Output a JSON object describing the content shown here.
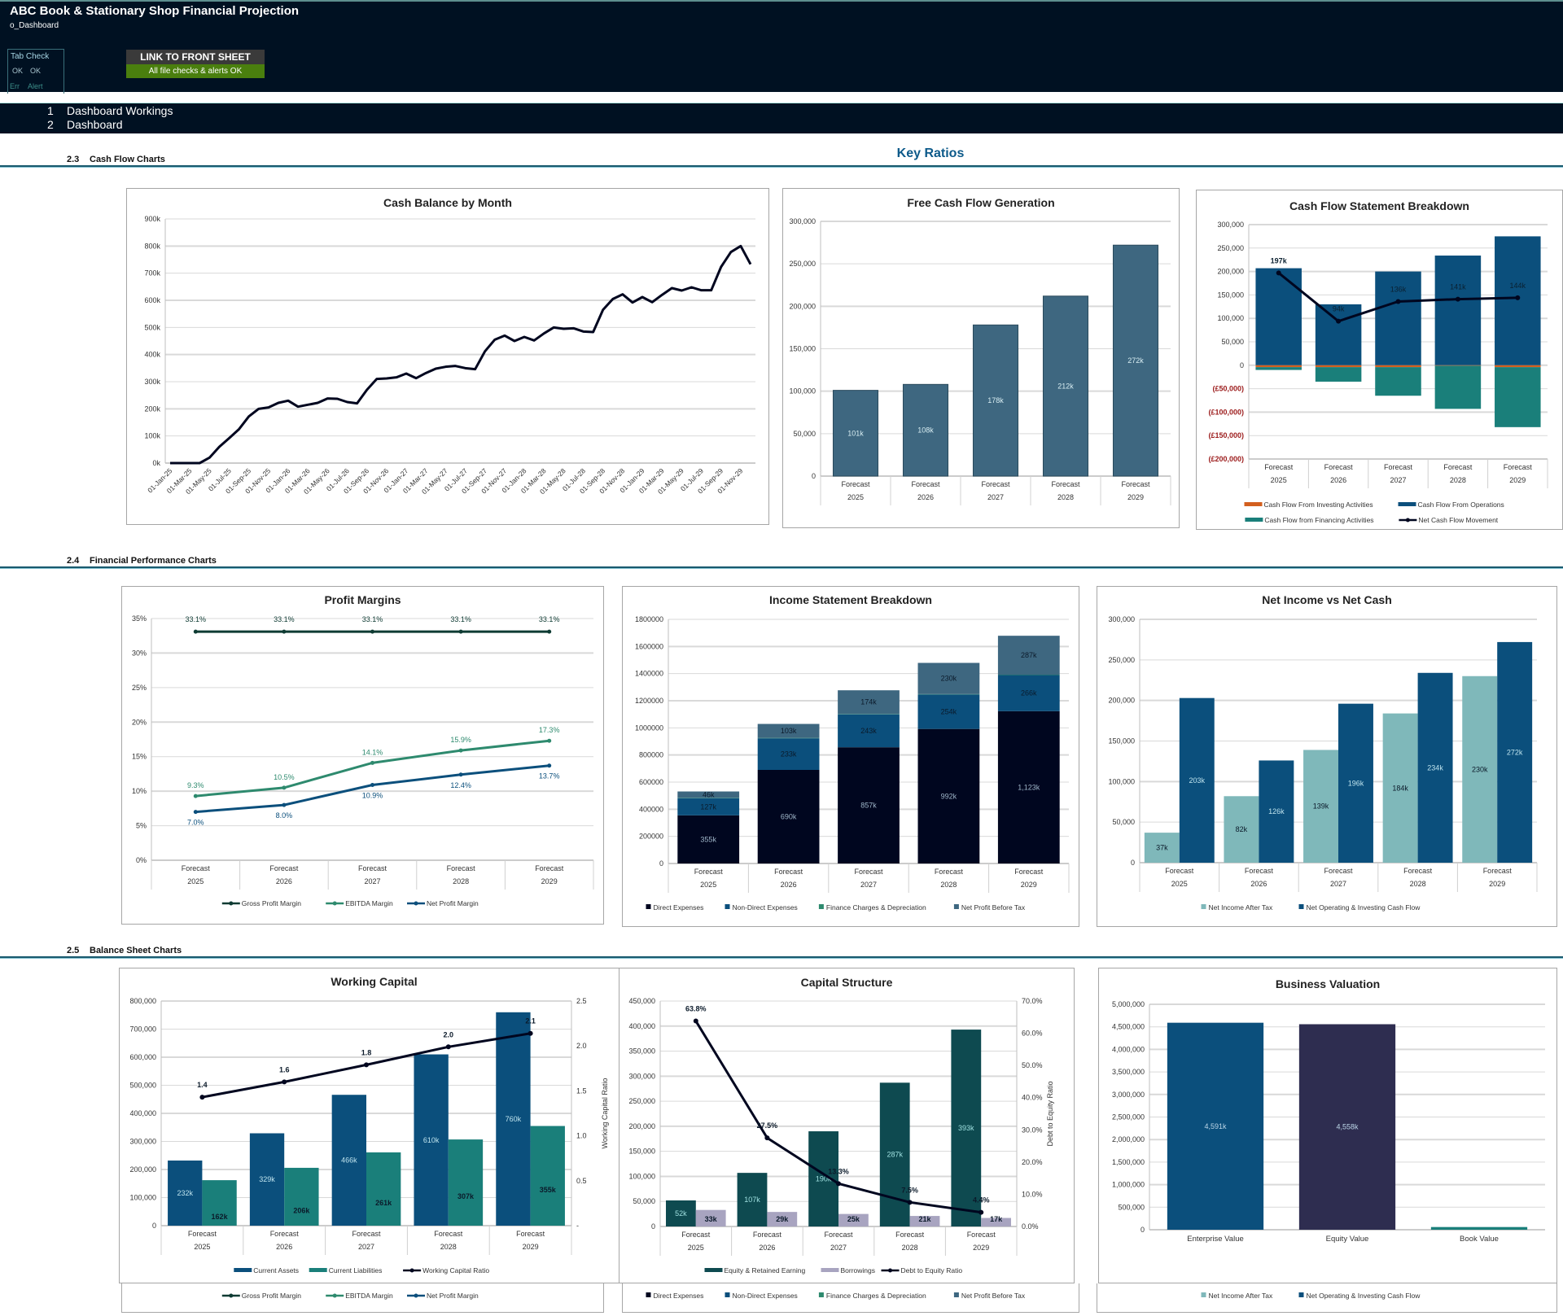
{
  "header": {
    "title": "ABC Book & Stationary Shop Financial Projection",
    "sheet_name": "o_Dashboard",
    "tab_check": {
      "label": "Tab Check",
      "status1": "OK",
      "status2": "OK",
      "err_label": "Err",
      "alert_label": "Alert"
    },
    "link_button": "LINK TO FRONT SHEET",
    "checks_status": "All file checks & alerts OK"
  },
  "nav": [
    {
      "num": "1",
      "label": "Dashboard Workings"
    },
    {
      "num": "2",
      "label": "Dashboard"
    }
  ],
  "key_ratios_title": "Key Ratios",
  "sections": [
    {
      "num": "2.3",
      "label": "Cash Flow Charts"
    },
    {
      "num": "2.4",
      "label": "Financial Performance Charts"
    },
    {
      "num": "2.5",
      "label": "Balance Sheet Charts"
    }
  ],
  "colors": {
    "header_bg": "#001122",
    "ok_green": "#4a7f0e",
    "accent_blue": "#0d5a8a",
    "navy": "#0b4f7c",
    "slate": "#3e6780",
    "teal": "#1a7f7a",
    "light_teal": "#7fb8ba",
    "dark_teal": "#0e4a50",
    "lavender": "#a8a4c0",
    "indigo": "#2e2d50",
    "near_black": "#00061f",
    "orange": "#d35f1e",
    "negative_red": "#9c1c1c"
  },
  "legend_strips": [
    [
      "Gross Profit Margin",
      "EBITDA Margin",
      "Net Profit Margin"
    ],
    [
      "Direct Expenses",
      "Non-Direct Expenses",
      "Finance Charges & Depreciation",
      "Net Profit Before Tax"
    ],
    [
      "Net Income After Tax",
      "Net Operating & Investing Cash Flow"
    ]
  ],
  "chart_data": [
    {
      "id": "cash-balance",
      "type": "line",
      "title": "Cash Balance by Month",
      "xlabel": "",
      "ylabel": "",
      "ylim": [
        0,
        900000
      ],
      "yticks": [
        "0k",
        "100k",
        "200k",
        "300k",
        "400k",
        "500k",
        "600k",
        "700k",
        "800k",
        "900k"
      ],
      "x_tick_labels": [
        "01-Jan-25",
        "01-Mar-25",
        "01-May-25",
        "01-Jul-25",
        "01-Sep-25",
        "01-Nov-25",
        "01-Jan-26",
        "01-Mar-26",
        "01-May-26",
        "01-Jul-26",
        "01-Sep-26",
        "01-Nov-26",
        "01-Jan-27",
        "01-Mar-27",
        "01-May-27",
        "01-Jul-27",
        "01-Sep-27",
        "01-Nov-27",
        "01-Jan-28",
        "01-Mar-28",
        "01-May-28",
        "01-Jul-28",
        "01-Sep-28",
        "01-Nov-28",
        "01-Jan-29",
        "01-Mar-29",
        "01-May-29",
        "01-Jul-29",
        "01-Sep-29",
        "01-Nov-29"
      ],
      "values": [
        0,
        0,
        0,
        0,
        20000,
        60000,
        92000,
        125000,
        172000,
        200000,
        205000,
        222000,
        230000,
        208000,
        215000,
        222000,
        238000,
        237000,
        225000,
        220000,
        270000,
        310000,
        312000,
        316000,
        330000,
        313000,
        332000,
        348000,
        355000,
        358000,
        350000,
        346000,
        412000,
        455000,
        470000,
        450000,
        465000,
        452000,
        478000,
        500000,
        495000,
        497000,
        485000,
        483000,
        565000,
        605000,
        622000,
        592000,
        612000,
        593000,
        620000,
        645000,
        636000,
        648000,
        637000,
        637000,
        723000,
        778000,
        800000,
        733000
      ],
      "grid": true,
      "legend": "none"
    },
    {
      "id": "free-cash-flow",
      "type": "bar",
      "title": "Free Cash Flow Generation",
      "categories": [
        [
          "Forecast",
          "2025"
        ],
        [
          "Forecast",
          "2026"
        ],
        [
          "Forecast",
          "2027"
        ],
        [
          "Forecast",
          "2028"
        ],
        [
          "Forecast",
          "2029"
        ]
      ],
      "values": [
        101000,
        108000,
        178000,
        212000,
        272000
      ],
      "data_labels": [
        "101k",
        "108k",
        "178k",
        "212k",
        "272k"
      ],
      "ylim": [
        0,
        300000
      ],
      "yticks": [
        "0",
        "50,000",
        "100,000",
        "150,000",
        "200,000",
        "250,000",
        "300,000"
      ],
      "grid": true,
      "legend": "none"
    },
    {
      "id": "cash-flow-statement",
      "type": "bar",
      "stacked": true,
      "title": "Cash Flow Statement Breakdown",
      "categories": [
        [
          "Forecast",
          "2025"
        ],
        [
          "Forecast",
          "2026"
        ],
        [
          "Forecast",
          "2027"
        ],
        [
          "Forecast",
          "2028"
        ],
        [
          "Forecast",
          "2029"
        ]
      ],
      "series": [
        {
          "name": "Cash Flow From Investing Activities",
          "kind": "bar",
          "color": "#d35f1e",
          "values": [
            -4000,
            -4000,
            -4000,
            -1000,
            -4000
          ]
        },
        {
          "name": "Cash Flow From Operations",
          "kind": "bar",
          "color": "#0b4f7c",
          "values": [
            207000,
            130000,
            200000,
            234000,
            275000
          ]
        },
        {
          "name": "Cash Flow from Financing Activities",
          "kind": "bar",
          "color": "#1a7f7a",
          "values": [
            -6000,
            -31000,
            -61000,
            -92000,
            -128000
          ]
        },
        {
          "name": "Net Cash Flow Movement",
          "kind": "line",
          "color": "#00061f",
          "values": [
            197000,
            94000,
            136000,
            141000,
            144000
          ],
          "data_labels": [
            "197k",
            "94k",
            "136k",
            "141k",
            "144k"
          ]
        }
      ],
      "ylim": [
        -200000,
        300000
      ],
      "yticks": [
        "(£200,000)",
        "(£150,000)",
        "(£100,000)",
        "(£50,000)",
        "0",
        "50,000",
        "100,000",
        "150,000",
        "200,000",
        "250,000",
        "300,000"
      ],
      "grid": true,
      "legend": "bottom"
    },
    {
      "id": "profit-margins",
      "type": "line",
      "title": "Profit Margins",
      "categories": [
        [
          "Forecast",
          "2025"
        ],
        [
          "Forecast",
          "2026"
        ],
        [
          "Forecast",
          "2027"
        ],
        [
          "Forecast",
          "2028"
        ],
        [
          "Forecast",
          "2029"
        ]
      ],
      "series": [
        {
          "name": "Gross Profit Margin",
          "color": "#0e3b33",
          "values": [
            33.1,
            33.1,
            33.1,
            33.1,
            33.1
          ],
          "data_labels": [
            "33.1%",
            "33.1%",
            "33.1%",
            "33.1%",
            "33.1%"
          ]
        },
        {
          "name": "EBITDA Margin",
          "color": "#2e8a6e",
          "values": [
            9.3,
            10.5,
            14.1,
            15.9,
            17.3
          ],
          "data_labels": [
            "9.3%",
            "10.5%",
            "14.1%",
            "15.9%",
            "17.3%"
          ]
        },
        {
          "name": "Net Profit Margin",
          "color": "#0b4f7c",
          "values": [
            7.0,
            8.0,
            10.9,
            12.4,
            13.7
          ],
          "data_labels": [
            "7.0%",
            "8.0%",
            "10.9%",
            "12.4%",
            "13.7%"
          ]
        }
      ],
      "ylim": [
        0,
        35
      ],
      "yticks": [
        "0%",
        "5%",
        "10%",
        "15%",
        "20%",
        "25%",
        "30%",
        "35%"
      ],
      "grid": true,
      "legend": "bottom"
    },
    {
      "id": "income-statement",
      "type": "bar",
      "stacked": true,
      "title": "Income Statement Breakdown",
      "categories": [
        [
          "Forecast",
          "2025"
        ],
        [
          "Forecast",
          "2026"
        ],
        [
          "Forecast",
          "2027"
        ],
        [
          "Forecast",
          "2028"
        ],
        [
          "Forecast",
          "2029"
        ]
      ],
      "series": [
        {
          "name": "Direct Expenses",
          "color": "#00061f",
          "values": [
            355000,
            690000,
            857000,
            992000,
            1123000
          ],
          "data_labels": [
            "355k",
            "690k",
            "857k",
            "992k",
            "1,123k"
          ]
        },
        {
          "name": "Non-Direct Expenses",
          "color": "#0b4f7c",
          "values": [
            127000,
            233000,
            243000,
            254000,
            266000
          ],
          "data_labels": [
            "127k",
            "233k",
            "243k",
            "254k",
            "266k"
          ]
        },
        {
          "name": "Finance Charges & Depreciation",
          "color": "#2e8a6e",
          "values": [
            3000,
            3000,
            3000,
            3000,
            3000
          ],
          "data_labels": [
            "",
            "",
            "",
            "",
            ""
          ]
        },
        {
          "name": "Net Profit Before Tax",
          "color": "#3e6780",
          "values": [
            46000,
            103000,
            174000,
            230000,
            287000
          ],
          "data_labels": [
            "46k",
            "103k",
            "174k",
            "230k",
            "287k"
          ]
        }
      ],
      "ylim": [
        0,
        1800000
      ],
      "yticks": [
        "0",
        "200000",
        "400000",
        "600000",
        "800000",
        "1000000",
        "1200000",
        "1400000",
        "1600000",
        "1800000"
      ],
      "grid": true,
      "legend": "bottom"
    },
    {
      "id": "net-income-vs-cash",
      "type": "bar",
      "title": "Net Income vs Net Cash",
      "categories": [
        [
          "Forecast",
          "2025"
        ],
        [
          "Forecast",
          "2026"
        ],
        [
          "Forecast",
          "2027"
        ],
        [
          "Forecast",
          "2028"
        ],
        [
          "Forecast",
          "2029"
        ]
      ],
      "series": [
        {
          "name": "Net Income After Tax",
          "color": "#7fb8ba",
          "values": [
            37000,
            82000,
            139000,
            184000,
            230000
          ],
          "data_labels": [
            "37k",
            "82k",
            "139k",
            "184k",
            "230k"
          ]
        },
        {
          "name": "Net Operating & Investing Cash Flow",
          "color": "#0b4f7c",
          "values": [
            203000,
            126000,
            196000,
            234000,
            272000
          ],
          "data_labels": [
            "203k",
            "126k",
            "196k",
            "234k",
            "272k"
          ]
        }
      ],
      "ylim": [
        0,
        300000
      ],
      "yticks": [
        "0",
        "50,000",
        "100,000",
        "150,000",
        "200,000",
        "250,000",
        "300,000"
      ],
      "grid": true,
      "legend": "bottom"
    },
    {
      "id": "working-capital",
      "type": "bar",
      "title": "Working Capital",
      "categories": [
        [
          "Forecast",
          "2025"
        ],
        [
          "Forecast",
          "2026"
        ],
        [
          "Forecast",
          "2027"
        ],
        [
          "Forecast",
          "2028"
        ],
        [
          "Forecast",
          "2029"
        ]
      ],
      "series": [
        {
          "name": "Current Assets",
          "kind": "bar",
          "color": "#0b4f7c",
          "values": [
            232000,
            329000,
            466000,
            610000,
            760000
          ],
          "data_labels": [
            "232k",
            "329k",
            "466k",
            "610k",
            "760k"
          ]
        },
        {
          "name": "Current Liabilities",
          "kind": "bar",
          "color": "#1a7f7a",
          "values": [
            162000,
            206000,
            261000,
            307000,
            355000
          ],
          "data_labels": [
            "162k",
            "206k",
            "261k",
            "307k",
            "355k"
          ]
        },
        {
          "name": "Working Capital Ratio",
          "kind": "line",
          "axis": "right",
          "color": "#00061f",
          "values": [
            1.43,
            1.6,
            1.79,
            1.99,
            2.14
          ],
          "data_labels": [
            "1.4",
            "1.6",
            "1.8",
            "2.0",
            "2.1"
          ]
        }
      ],
      "ylim": [
        0,
        800000
      ],
      "y2lim": [
        0,
        2.5
      ],
      "yticks": [
        "0",
        "100,000",
        "200,000",
        "300,000",
        "400,000",
        "500,000",
        "600,000",
        "700,000",
        "800,000"
      ],
      "y2ticks": [
        "-",
        "0.5",
        "1.0",
        "1.5",
        "2.0",
        "2.5"
      ],
      "y2label": "Working Capital Ratio",
      "grid": true,
      "legend": "bottom"
    },
    {
      "id": "capital-structure",
      "type": "bar",
      "title": "Capital Structure",
      "categories": [
        [
          "Forecast",
          "2025"
        ],
        [
          "Forecast",
          "2026"
        ],
        [
          "Forecast",
          "2027"
        ],
        [
          "Forecast",
          "2028"
        ],
        [
          "Forecast",
          "2029"
        ]
      ],
      "series": [
        {
          "name": "Equity & Retained Earning",
          "kind": "bar",
          "color": "#0e4a50",
          "values": [
            52000,
            107000,
            190000,
            287000,
            393000
          ],
          "data_labels": [
            "52k",
            "107k",
            "190k",
            "287k",
            "393k"
          ]
        },
        {
          "name": "Borrowings",
          "kind": "bar",
          "color": "#a8a4c0",
          "values": [
            33000,
            29000,
            25000,
            21000,
            17000
          ],
          "data_labels": [
            "33k",
            "29k",
            "25k",
            "21k",
            "17k"
          ]
        },
        {
          "name": "Debt to Equity Ratio",
          "kind": "line",
          "axis": "right",
          "color": "#00061f",
          "values": [
            63.8,
            27.5,
            13.3,
            7.5,
            4.4
          ],
          "data_labels": [
            "63.8%",
            "27.5%",
            "13.3%",
            "7.5%",
            "4.4%"
          ]
        }
      ],
      "ylim": [
        0,
        450000
      ],
      "y2lim": [
        0,
        70
      ],
      "yticks": [
        "0",
        "50,000",
        "100,000",
        "150,000",
        "200,000",
        "250,000",
        "300,000",
        "350,000",
        "400,000",
        "450,000"
      ],
      "y2ticks": [
        "0.0%",
        "10.0%",
        "20.0%",
        "30.0%",
        "40.0%",
        "50.0%",
        "60.0%",
        "70.0%"
      ],
      "y2label": "Debt to Equity Ratio",
      "grid": true,
      "legend": "bottom"
    },
    {
      "id": "business-valuation",
      "type": "bar",
      "title": "Business Valuation",
      "categories": [
        "Enterprise Value",
        "Equity Value",
        "Book Value"
      ],
      "values": [
        4591000,
        4558000,
        60000
      ],
      "colors": [
        "#0b4f7c",
        "#2e2d50",
        "#1a7f7a"
      ],
      "data_labels": [
        "4,591k",
        "4,558k",
        ""
      ],
      "ylim": [
        0,
        5000000
      ],
      "yticks": [
        "0",
        "500,000",
        "1,000,000",
        "1,500,000",
        "2,000,000",
        "2,500,000",
        "3,000,000",
        "3,500,000",
        "4,000,000",
        "4,500,000",
        "5,000,000"
      ],
      "grid": true,
      "legend": "none"
    }
  ]
}
